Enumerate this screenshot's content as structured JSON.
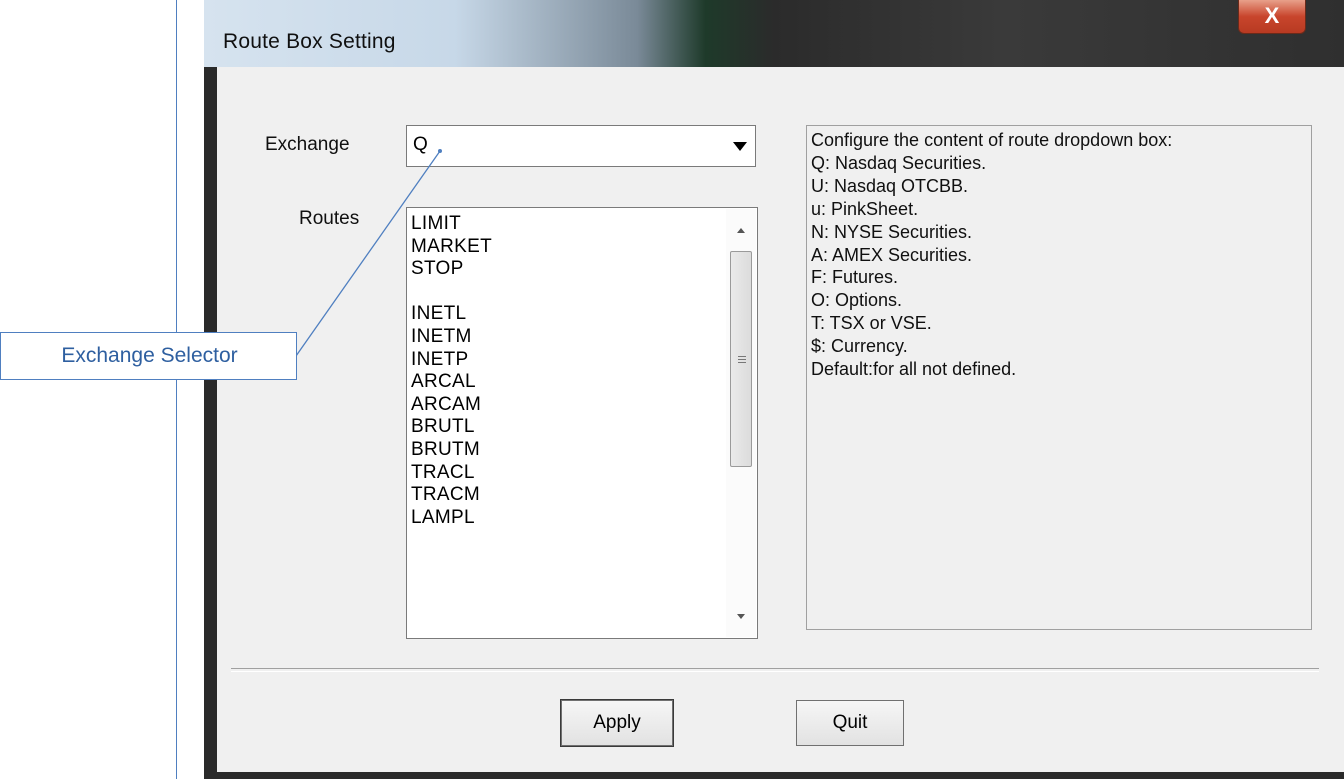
{
  "window": {
    "title": "Route Box Setting",
    "close_label": "X"
  },
  "exchange": {
    "label": "Exchange",
    "value": "Q"
  },
  "routes": {
    "label": "Routes",
    "items": [
      "LIMIT",
      "MARKET",
      "STOP",
      "",
      "INETL",
      "INETM",
      "INETP",
      "ARCAL",
      "ARCAM",
      "BRUTL",
      "BRUTM",
      "TRACL",
      "TRACM",
      "LAMPL"
    ]
  },
  "info": {
    "heading": "Configure the content of route dropdown box:",
    "lines": [
      "Q: Nasdaq Securities.",
      "U: Nasdaq OTCBB.",
      "u: PinkSheet.",
      "N: NYSE Securities.",
      "A: AMEX Securities.",
      "F: Futures.",
      "O: Options.",
      "T: TSX or VSE.",
      "$: Currency.",
      "Default:for all not defined."
    ]
  },
  "buttons": {
    "apply": "Apply",
    "quit": "Quit"
  },
  "callout": {
    "label": "Exchange Selector"
  },
  "colors": {
    "callout_border": "#4f7fc0",
    "callout_text": "#2e5fa0",
    "close_button": "#c8452c"
  }
}
